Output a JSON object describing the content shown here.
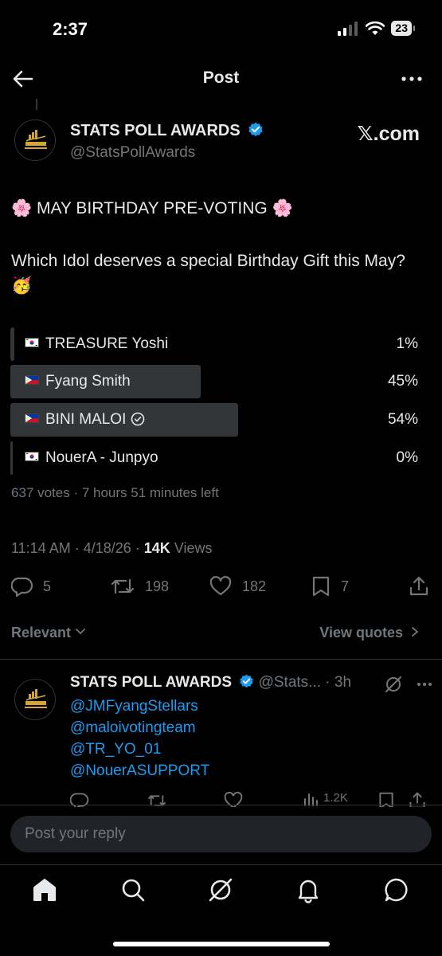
{
  "status": {
    "time": "2:37",
    "battery": "23"
  },
  "header": {
    "title": "Post"
  },
  "post": {
    "author_name": "STATS POLL AWARDS",
    "author_handle": "@StatsPollAwards",
    "source": "𝕏.com",
    "headline": "🌸 MAY BIRTHDAY PRE-VOTING 🌸",
    "body": "Which Idol deserves a special Birthday Gift this May? 🥳",
    "poll": {
      "options": [
        {
          "label": "TREASURE Yoshi",
          "flag": "south-korea-flag",
          "percent": "1%",
          "value": 1
        },
        {
          "label": "Fyang Smith",
          "flag": "philippines-flag",
          "percent": "45%",
          "value": 45
        },
        {
          "label": "BINI MALOI",
          "flag": "philippines-flag",
          "percent": "54%",
          "value": 54,
          "selected": true
        },
        {
          "label": "NouerA - Junpyo",
          "flag": "south-korea-flag",
          "percent": "0%",
          "value": 0
        }
      ],
      "meta": "637 votes · 7 hours 51 minutes left"
    },
    "timestamp": "11:14 AM · 4/18/26 · ",
    "views_count": "14K",
    "views_label": " Views",
    "stats": {
      "replies": "5",
      "reposts": "198",
      "likes": "182",
      "bookmarks": "7"
    }
  },
  "replies_header": {
    "sort_label": "Relevant",
    "view_quotes": "View quotes"
  },
  "reply": {
    "author_name": "STATS POLL AWARDS",
    "meta": " @Stats... · 3h",
    "mentions": [
      "@JMFyangStellars",
      "@maloivotingteam",
      "@TR_YO_01",
      "@NouerASUPPORT"
    ],
    "views": "1.2K"
  },
  "composer": {
    "placeholder": "Post your reply"
  },
  "colors": {
    "accent": "#1d9bf0",
    "bar": "#333639",
    "muted": "#71767b"
  }
}
